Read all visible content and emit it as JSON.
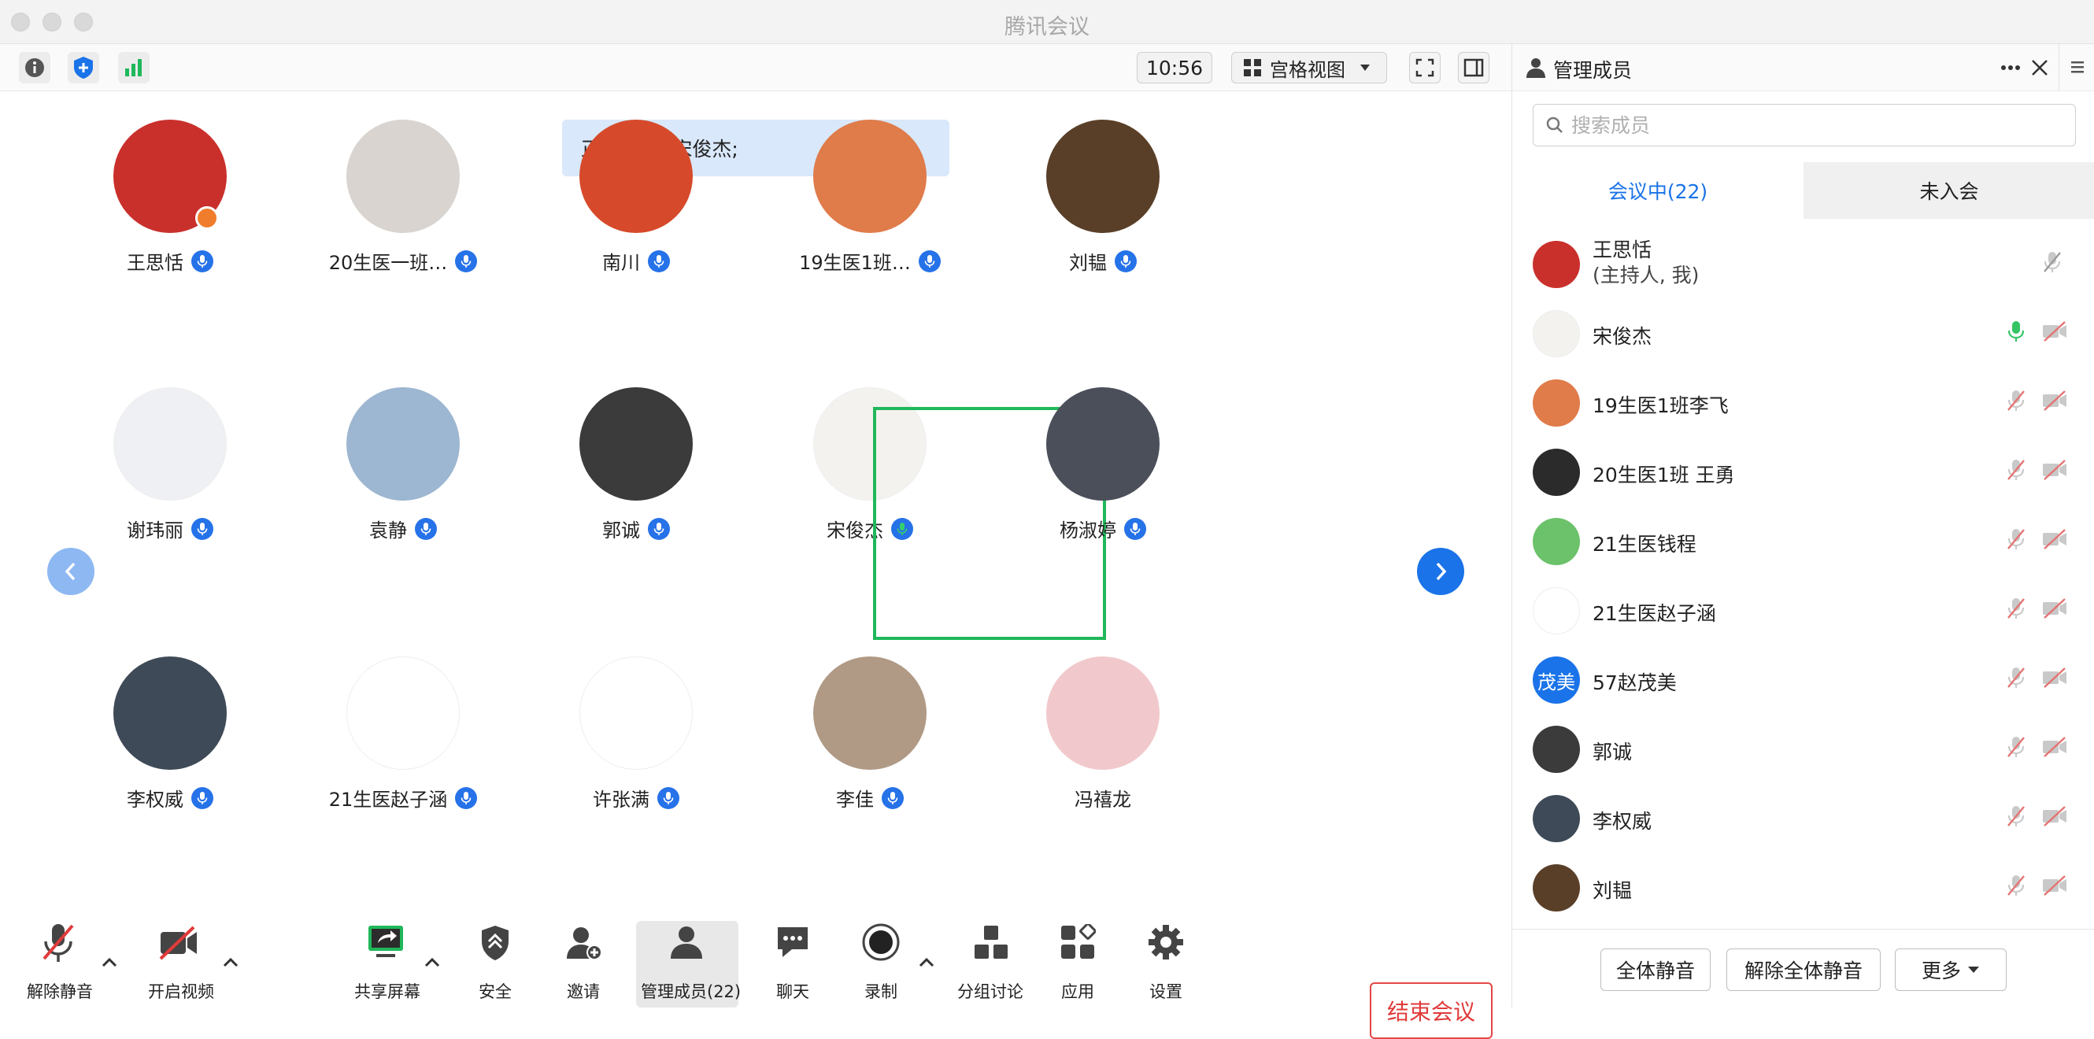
{
  "window": {
    "title": "腾讯会议"
  },
  "topbar": {
    "time": "10:56",
    "view_label": "宫格视图"
  },
  "speaking_banner": "正在讲话: 宋俊杰;",
  "grid": [
    {
      "name": "王思恬",
      "avatar_color": "#c9302c",
      "mic": "blue",
      "host": true
    },
    {
      "name": "20生医一班…",
      "avatar_color": "#d9d4cf",
      "mic": "blue"
    },
    {
      "name": "南川",
      "avatar_color": "#d64a2b",
      "mic": "blue"
    },
    {
      "name": "19生医1班…",
      "avatar_color": "#e07b4a",
      "mic": "blue"
    },
    {
      "name": "刘韫",
      "avatar_color": "#5a3f28",
      "mic": "blue"
    },
    {
      "name": "谢玮丽",
      "avatar_color": "#eef0f3",
      "mic": "blue"
    },
    {
      "name": "袁静",
      "avatar_color": "#9db6d1",
      "mic": "blue"
    },
    {
      "name": "郭诚",
      "avatar_color": "#3b3b3b",
      "mic": "blue"
    },
    {
      "name": "宋俊杰",
      "avatar_color": "#f4f2ef",
      "mic": "green",
      "active": true
    },
    {
      "name": "杨淑婷",
      "avatar_color": "#4a4f5a",
      "mic": "blue"
    },
    {
      "name": "李权威",
      "avatar_color": "#3e4a57",
      "mic": "blue"
    },
    {
      "name": "21生医赵子涵",
      "avatar_color": "#ffffff",
      "mic": "blue"
    },
    {
      "name": "许张满",
      "avatar_color": "#ffffff",
      "mic": "blue"
    },
    {
      "name": "李佳",
      "avatar_color": "#b09a85",
      "mic": "blue"
    },
    {
      "name": "冯禧龙",
      "avatar_color": "#f1c9cc",
      "mic": "none"
    }
  ],
  "toolbar": {
    "unmute": "解除静音",
    "start_video": "开启视频",
    "share_screen": "共享屏幕",
    "security": "安全",
    "invite": "邀请",
    "manage_members": "管理成员(22)",
    "chat": "聊天",
    "record": "录制",
    "breakout": "分组讨论",
    "apps": "应用",
    "settings": "设置",
    "end_meeting": "结束会议"
  },
  "panel": {
    "title": "管理成员",
    "search_placeholder": "搜索成员",
    "tab_in_meeting": "会议中(22)",
    "tab_not_joined": "未入会",
    "members": [
      {
        "name": "王思恬",
        "sub": "(主持人, 我)",
        "avatar_color": "#c9302c",
        "mic": "muted-gray",
        "cam": "none"
      },
      {
        "name": "宋俊杰",
        "avatar_color": "#f4f2ef",
        "mic": "green",
        "cam": "off"
      },
      {
        "name": "19生医1班李飞",
        "avatar_color": "#e07b4a",
        "mic": "muted",
        "cam": "off"
      },
      {
        "name": "20生医1班 王勇",
        "avatar_color": "#2b2b2b",
        "mic": "muted",
        "cam": "off"
      },
      {
        "name": "21生医钱程",
        "avatar_color": "#6cc26a",
        "mic": "muted",
        "cam": "off"
      },
      {
        "name": "21生医赵子涵",
        "avatar_color": "#ffffff",
        "mic": "muted",
        "cam": "off"
      },
      {
        "name": "57赵茂美",
        "avatar_text": "茂美",
        "avatar_color": "#1a73e8",
        "mic": "muted",
        "cam": "off"
      },
      {
        "name": "郭诚",
        "avatar_color": "#3b3b3b",
        "mic": "muted",
        "cam": "off"
      },
      {
        "name": "李权威",
        "avatar_color": "#3e4a57",
        "mic": "muted",
        "cam": "off"
      },
      {
        "name": "刘韫",
        "avatar_color": "#5a3f28",
        "mic": "muted",
        "cam": "off"
      }
    ],
    "mute_all": "全体静音",
    "unmute_all": "解除全体静音",
    "more": "更多"
  }
}
